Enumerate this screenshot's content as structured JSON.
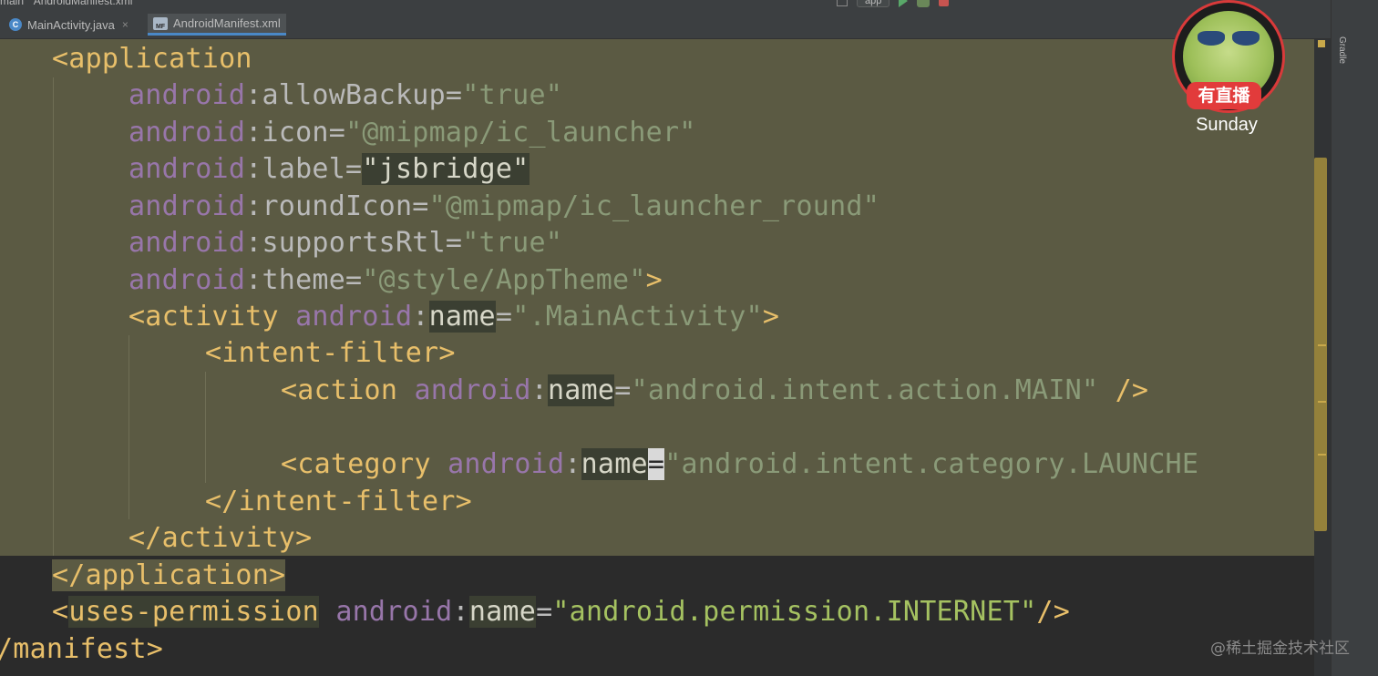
{
  "breadcrumb": {
    "items": [
      "main",
      "AndroidManifest.xml"
    ]
  },
  "toolbar": {
    "run_config": "app"
  },
  "tabs": [
    {
      "label": "MainActivity.java",
      "icon": "java-class-icon",
      "active": false
    },
    {
      "label": "AndroidManifest.xml",
      "icon": "xml-file-icon",
      "active": true
    }
  ],
  "side_panel": {
    "gradle_label": "Gradle"
  },
  "code": {
    "l1_tag": "<application",
    "l2_ns": "android",
    "l2_attr": ":allowBackup=",
    "l2_val": "\"true\"",
    "l3_ns": "android",
    "l3_attr": ":icon=",
    "l3_val": "\"@mipmap/ic_launcher\"",
    "l4_ns": "android",
    "l4_attr": ":label=",
    "l4_val": "\"jsbridge\"",
    "l5_ns": "android",
    "l5_attr": ":roundIcon=",
    "l5_val": "\"@mipmap/ic_launcher_round\"",
    "l6_ns": "android",
    "l6_attr": ":supportsRtl=",
    "l6_val": "\"true\"",
    "l7_ns": "android",
    "l7_attr": ":theme=",
    "l7_val": "\"@style/AppTheme\"",
    "l7_close": ">",
    "l8_tag": "<activity",
    "l8_ns": "android",
    "l8_colon": ":",
    "l8_attr": "name",
    "l8_eq": "=",
    "l8_val": "\".MainActivity\"",
    "l8_close": ">",
    "l9_tag": "<intent-filter>",
    "l10_tag": "<action",
    "l10_ns": "android",
    "l10_colon": ":",
    "l10_attr": "name",
    "l10_eq": "=",
    "l10_val": "\"android.intent.action.MAIN\"",
    "l10_close": "/>",
    "l12_tag": "<category",
    "l12_ns": "android",
    "l12_colon": ":",
    "l12_attr": "name",
    "l12_eq": "=",
    "l12_val": "\"android.intent.category.LAUNCHE",
    "l13_tag": "</intent-filter>",
    "l14_tag": "</activity>",
    "l15_tag": "</application>",
    "l16_open": "<",
    "l16_tag": "uses-permission",
    "l16_ns": "android",
    "l16_colon": ":",
    "l16_attr": "name",
    "l16_eq": "=",
    "l16_val": "\"android.permission.INTERNET\"",
    "l16_close": "/>",
    "l17_tag": "/manifest>"
  },
  "overlay": {
    "live_badge": "有直播",
    "streamer_name": "Sunday",
    "watermark": "@稀土掘金技术社区"
  },
  "colors": {
    "tag": "#e8bf6a",
    "namespace": "#9876aa",
    "string": "#a5c261",
    "highlight_block": "#5b5a43",
    "live_badge": "#e23b3b"
  }
}
